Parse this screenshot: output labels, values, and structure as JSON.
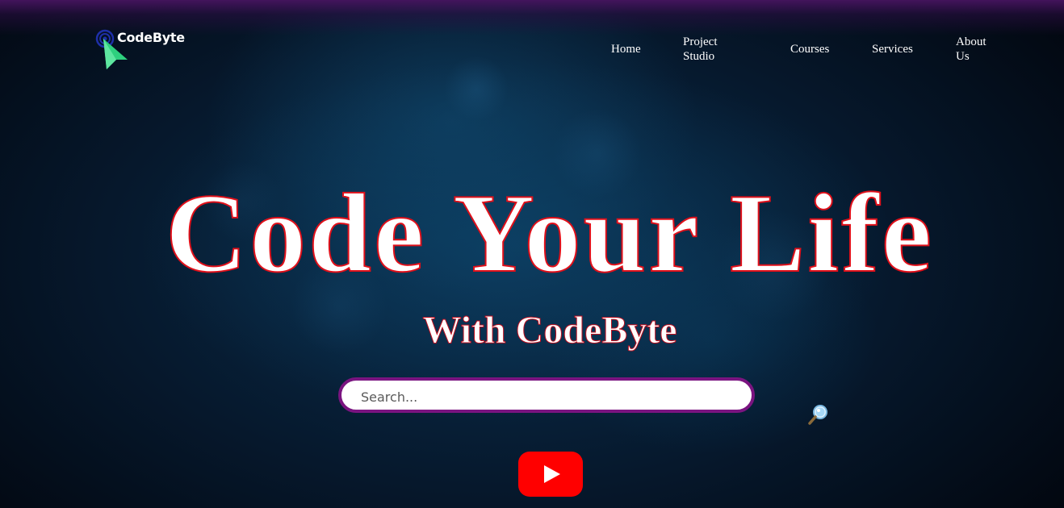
{
  "brand": {
    "name": "CodeByte"
  },
  "nav": {
    "items": [
      {
        "label": "Home"
      },
      {
        "label": "Project Studio"
      },
      {
        "label": "Courses"
      },
      {
        "label": "Services"
      },
      {
        "label": "About Us"
      }
    ]
  },
  "hero": {
    "title": "Code Your Life",
    "subtitle": "With CodeByte"
  },
  "search": {
    "placeholder": "Search...",
    "value": ""
  },
  "icons": {
    "logo": "codebyte-logo-icon",
    "search": "magnifier-icon",
    "video": "youtube-play-icon"
  },
  "colors": {
    "title_stroke": "#e0101a",
    "search_border": "#7a1480",
    "youtube_red": "#ff0000",
    "logo_green": "#2ed07e",
    "top_glow": "#46145f"
  }
}
